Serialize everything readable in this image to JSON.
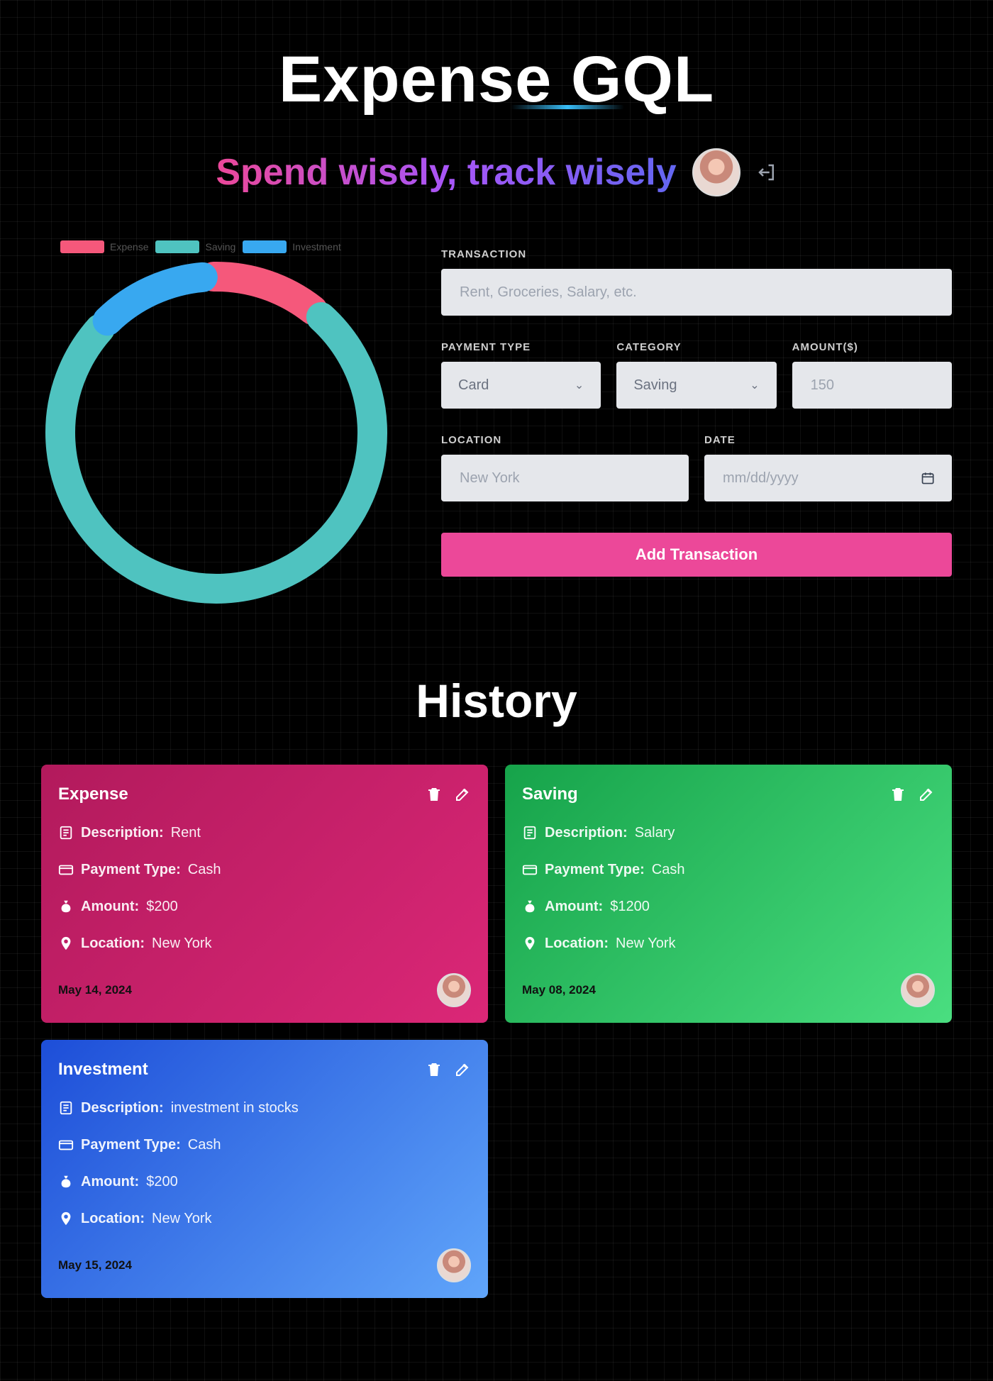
{
  "header": {
    "title": "Expense GQL",
    "tagline": "Spend wisely, track wisely"
  },
  "chart_data": {
    "type": "pie",
    "variant": "doughnut",
    "legend_position": "top",
    "series": [
      {
        "name": "Expense",
        "value": 12,
        "color": "#f5587b"
      },
      {
        "name": "Saving",
        "value": 76,
        "color": "#4fc3c0"
      },
      {
        "name": "Investment",
        "value": 12,
        "color": "#38a8f0"
      }
    ]
  },
  "form": {
    "transaction_label": "Transaction",
    "transaction_placeholder": "Rent, Groceries, Salary, etc.",
    "payment_type_label": "Payment Type",
    "payment_type_value": "Card",
    "category_label": "Category",
    "category_value": "Saving",
    "amount_label": "Amount($)",
    "amount_placeholder": "150",
    "location_label": "Location",
    "location_placeholder": "New York",
    "date_label": "Date",
    "date_placeholder": "mm/dd/yyyy",
    "submit_label": "Add Transaction"
  },
  "history": {
    "title": "History",
    "cards": [
      {
        "category": "Expense",
        "description": "Rent",
        "payment_type": "Cash",
        "amount": "$200",
        "location": "New York",
        "date": "May 14, 2024"
      },
      {
        "category": "Saving",
        "description": "Salary",
        "payment_type": "Cash",
        "amount": "$1200",
        "location": "New York",
        "date": "May 08, 2024"
      },
      {
        "category": "Investment",
        "description": "investment in stocks",
        "payment_type": "Cash",
        "amount": "$200",
        "location": "New York",
        "date": "May 15, 2024"
      }
    ],
    "labels": {
      "description": "Description:",
      "payment_type": "Payment Type:",
      "amount": "Amount:",
      "location": "Location:"
    }
  }
}
